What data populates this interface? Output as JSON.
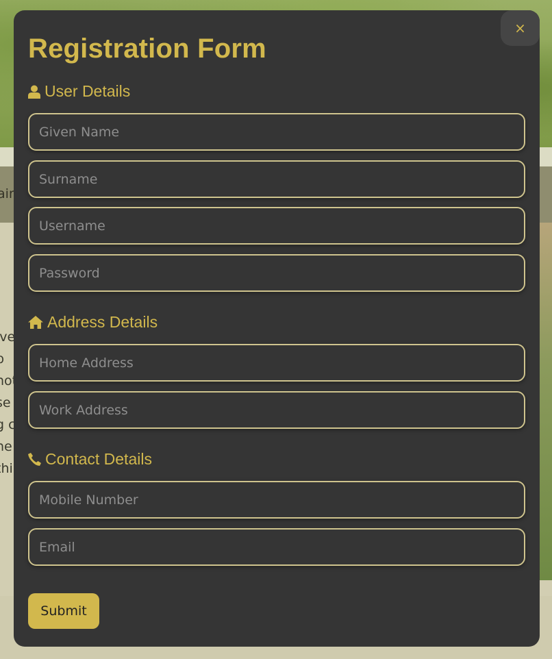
{
  "background": {
    "navbar_text": "air,",
    "lines": [
      "ive",
      "b",
      "hot",
      "se",
      "g c",
      "ne",
      "thi"
    ]
  },
  "modal": {
    "title": "Registration Form",
    "close_label": "×",
    "sections": {
      "user": {
        "heading": "User Details",
        "icon": "user-icon",
        "fields": {
          "given_name": "Given Name",
          "surname": "Surname",
          "username": "Username",
          "password": "Password"
        }
      },
      "address": {
        "heading": "Address Details",
        "icon": "home-icon",
        "fields": {
          "home_address": "Home Address",
          "work_address": "Work Address"
        }
      },
      "contact": {
        "heading": "Contact Details",
        "icon": "phone-icon",
        "fields": {
          "mobile": "Mobile Number",
          "email": "Email"
        }
      }
    },
    "submit_label": "Submit"
  },
  "colors": {
    "accent": "#d2b84d",
    "modal_bg": "#353535",
    "field_border": "#cfc48e",
    "placeholder": "#8e8e8e"
  }
}
